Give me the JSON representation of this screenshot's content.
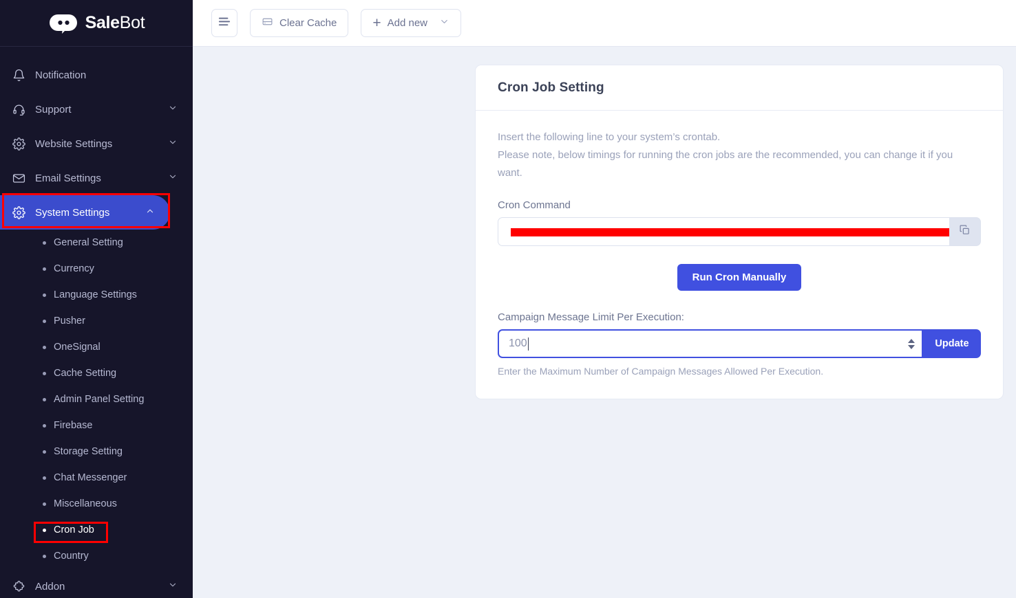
{
  "brand": {
    "name_bold": "Sale",
    "name_light": "Bot",
    "logo_icon": "robot-face-icon"
  },
  "sidebar": {
    "items": [
      {
        "label": "Notification",
        "icon": "bell-icon",
        "chevron": false,
        "active": false
      },
      {
        "label": "Support",
        "icon": "headset-icon",
        "chevron": true,
        "active": false
      },
      {
        "label": "Website Settings",
        "icon": "gear-icon",
        "chevron": true,
        "active": false
      },
      {
        "label": "Email Settings",
        "icon": "envelope-icon",
        "chevron": true,
        "active": false
      },
      {
        "label": "System Settings",
        "icon": "gear-icon",
        "chevron": true,
        "active": true
      }
    ],
    "sub_items": [
      {
        "label": "General Setting",
        "current": false
      },
      {
        "label": "Currency",
        "current": false
      },
      {
        "label": "Language Settings",
        "current": false
      },
      {
        "label": "Pusher",
        "current": false
      },
      {
        "label": "OneSignal",
        "current": false
      },
      {
        "label": "Cache Setting",
        "current": false
      },
      {
        "label": "Admin Panel Setting",
        "current": false
      },
      {
        "label": "Firebase",
        "current": false
      },
      {
        "label": "Storage Setting",
        "current": false
      },
      {
        "label": "Chat Messenger",
        "current": false
      },
      {
        "label": "Miscellaneous",
        "current": false
      },
      {
        "label": "Cron Job",
        "current": true
      },
      {
        "label": "Country",
        "current": false
      }
    ],
    "footer_item": {
      "label": "Addon",
      "icon": "puzzle-piece-icon",
      "chevron": true
    }
  },
  "topbar": {
    "menu_icon": "hamburger-menu-icon",
    "clear_cache_label": "Clear Cache",
    "clear_cache_icon": "database-icon",
    "add_new_label": "Add new",
    "add_new_plus": "+",
    "add_new_chevron": "chevron-down-icon"
  },
  "card": {
    "title": "Cron Job Setting",
    "intro_line1": "Insert the following line to your system’s crontab.",
    "intro_line2": "Please note, below timings for running the cron jobs are the recommended, you can change it if you want.",
    "cron_command_label": "Cron Command",
    "cron_command_value": "",
    "cron_command_redacted": true,
    "copy_icon": "copy-icon",
    "run_cron_label": "Run Cron Manually",
    "limit_label": "Campaign Message Limit Per Execution:",
    "limit_value": "100",
    "update_label": "Update",
    "hint": "Enter the Maximum Number of Campaign Messages Allowed Per Execution."
  },
  "annotations": [
    {
      "name": "system-settings-highlight",
      "color": "#ff0000"
    },
    {
      "name": "cron-job-highlight",
      "color": "#ff0000"
    }
  ],
  "colors": {
    "sidebar_bg": "#16152a",
    "accent_blue": "#4050e0",
    "active_nav": "#3b4ccd",
    "content_bg": "#eef1f8",
    "annotation_red": "#ff0000"
  }
}
